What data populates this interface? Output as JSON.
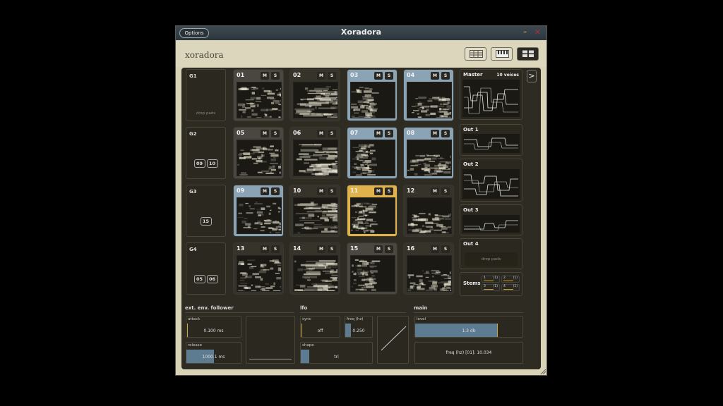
{
  "window": {
    "title": "Xoradora",
    "options_label": "Options",
    "minimize": "–",
    "close": "✕"
  },
  "header": {
    "brand": "xoradora",
    "view_buttons": [
      "grid-view-icon",
      "keyboard-view-icon",
      "pads-view-icon"
    ],
    "selected_view": 2
  },
  "groups": [
    {
      "label": "G1",
      "drop_text": "drop pads",
      "chips": []
    },
    {
      "label": "G2",
      "drop_text": "",
      "chips": [
        "09",
        "10"
      ]
    },
    {
      "label": "G3",
      "drop_text": "",
      "chips": [
        "15"
      ]
    },
    {
      "label": "G4",
      "drop_text": "",
      "chips": [
        "05",
        "06"
      ]
    }
  ],
  "pads": [
    {
      "num": "01",
      "m": "M",
      "s": "S",
      "state": "normal"
    },
    {
      "num": "02",
      "m": "M",
      "s": "S",
      "state": "plain"
    },
    {
      "num": "03",
      "m": "M",
      "s": "S",
      "state": "highlight"
    },
    {
      "num": "04",
      "m": "M",
      "s": "S",
      "state": "highlight"
    },
    {
      "num": "05",
      "m": "M",
      "s": "S",
      "state": "normal"
    },
    {
      "num": "06",
      "m": "M",
      "s": "S",
      "state": "plain"
    },
    {
      "num": "07",
      "m": "M",
      "s": "S",
      "state": "highlight"
    },
    {
      "num": "08",
      "m": "M",
      "s": "S",
      "state": "highlight"
    },
    {
      "num": "09",
      "m": "M",
      "s": "S",
      "state": "highlight"
    },
    {
      "num": "10",
      "m": "M",
      "s": "S",
      "state": "plain"
    },
    {
      "num": "11",
      "m": "M",
      "s": "S",
      "state": "selected"
    },
    {
      "num": "12",
      "m": "M",
      "s": "S",
      "state": "plain"
    },
    {
      "num": "13",
      "m": "M",
      "s": "S",
      "state": "plain"
    },
    {
      "num": "14",
      "m": "M",
      "s": "S",
      "state": "plain"
    },
    {
      "num": "15",
      "m": "M",
      "s": "S",
      "state": "normal"
    },
    {
      "num": "16",
      "m": "M",
      "s": "S",
      "state": "plain"
    }
  ],
  "outputs": {
    "master": {
      "label": "Master",
      "voices": "10 voices"
    },
    "out1": {
      "label": "Out 1"
    },
    "out2": {
      "label": "Out 2"
    },
    "out3": {
      "label": "Out 3"
    },
    "out4": {
      "label": "Out 4",
      "drop_text": "drop pads"
    },
    "stems": {
      "label": "Stems",
      "items": [
        {
          "n": "1",
          "v": "(1)"
        },
        {
          "n": "2",
          "v": "(1)"
        },
        {
          "n": "3",
          "v": "(1)"
        },
        {
          "n": "4",
          "v": "(1)"
        }
      ]
    },
    "next": ">"
  },
  "env_follower": {
    "title": "ext. env. follower",
    "attack": {
      "label": "attack",
      "value": "0.100 ms",
      "fraction": 0.0
    },
    "release": {
      "label": "release",
      "value": "1000.1 ms",
      "fraction": 0.5
    }
  },
  "lfo": {
    "title": "lfo",
    "sync": {
      "label": "sync",
      "value": "off",
      "fraction": 0.0
    },
    "freq": {
      "label": "freq (hz)",
      "value": "0.250",
      "fraction": 0.22
    },
    "shape": {
      "label": "shape",
      "value": "tri",
      "fraction": 0.12
    }
  },
  "main": {
    "title": "main",
    "level": {
      "label": "level",
      "value": "1.3 db",
      "fraction": 0.76
    },
    "freq_readout": "freq (hz) [01]: 10.034"
  },
  "colors": {
    "pad_normal": "#4a4640",
    "pad_highlight": "#8aa3b5",
    "pad_selected": "#e0b24c",
    "panel": "#2e2b23",
    "frame": "#d8d2b6",
    "slider_fill": "#5d7c92",
    "accent": "#c9a53a"
  }
}
